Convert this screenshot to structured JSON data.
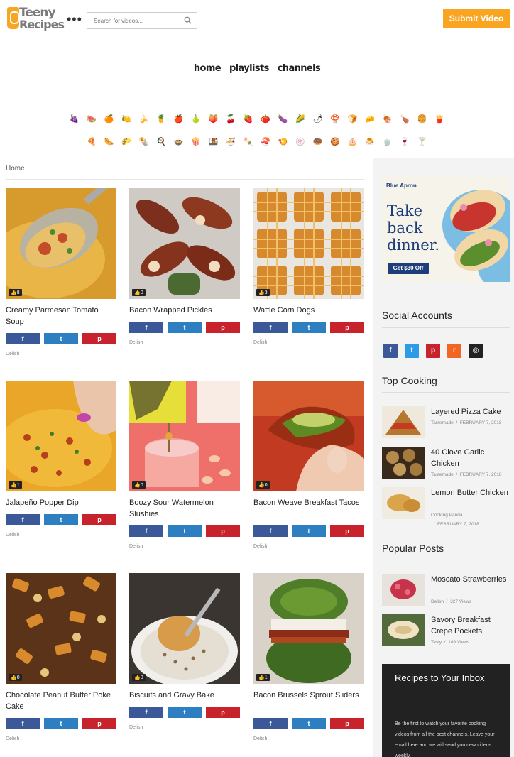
{
  "header": {
    "logo_line1": "Teeny",
    "logo_line2": "Recipes",
    "more_label": "•••",
    "search_placeholder": "Search for videos...",
    "submit_label": "Submit Video"
  },
  "nav": {
    "items": [
      "home",
      "playlists",
      "channels"
    ]
  },
  "categories": {
    "row1": [
      "🍇",
      "🍉",
      "🍊",
      "🍋",
      "🍌",
      "🍍",
      "🍎",
      "🍐",
      "🍑",
      "🍒",
      "🍓",
      "🍅",
      "🍆",
      "🌽",
      "🌶",
      "🍄",
      "🍞",
      "🧀",
      "🍖",
      "🍗",
      "🍔",
      "🍟"
    ],
    "row2": [
      "🍕",
      "🌭",
      "🌮",
      "🌯",
      "🍳",
      "🍲",
      "🍿",
      "🍱",
      "🍜",
      "🍡",
      "🍣",
      "🍤",
      "🍥",
      "🍩",
      "🍪",
      "🎂",
      "🍮",
      "🍵",
      "🍷",
      "🍸"
    ]
  },
  "breadcrumb": "Home",
  "share": {
    "facebook": "f",
    "twitter": "t",
    "pinterest": "p"
  },
  "cards": [
    {
      "title": "Creamy Parmesan Tomato Soup",
      "likes": "8",
      "source": "Delish"
    },
    {
      "title": "Bacon Wrapped Pickles",
      "likes": "0",
      "source": "Delish"
    },
    {
      "title": "Waffle Corn Dogs",
      "likes": "3",
      "source": "Delish"
    },
    {
      "title": "Jalapeño Popper Dip",
      "likes": "1",
      "source": "Delish"
    },
    {
      "title": "Boozy Sour Watermelon Slushies",
      "likes": "0",
      "source": "Delish"
    },
    {
      "title": "Bacon Weave Breakfast Tacos",
      "likes": "0",
      "source": "Delish"
    },
    {
      "title": "Chocolate Peanut Butter Poke Cake",
      "likes": "0",
      "source": "Delish"
    },
    {
      "title": "Biscuits and Gravy Bake",
      "likes": "0",
      "source": "Delish"
    },
    {
      "title": "Bacon Brussels Sprout Sliders",
      "likes": "1",
      "source": "Delish"
    }
  ],
  "ad": {
    "brand": "Blue Apron",
    "line1": "Take",
    "line2": "back",
    "line3": "dinner.",
    "cta": "Get $30 Off"
  },
  "sidebar": {
    "social_title": "Social Accounts",
    "top_title": "Top Cooking",
    "popular_title": "Popular Posts",
    "top_items": [
      {
        "title": "Layered Pizza Cake",
        "source": "Tastemade",
        "date": "FEBRUARY 7, 2018"
      },
      {
        "title": "40 Clove Garlic Chicken",
        "source": "Tastemade",
        "date": "FEBRUARY 7, 2018"
      },
      {
        "title": "Lemon Butter Chicken",
        "source": "Cooking Panda",
        "date": "FEBRUARY 7, 2018"
      }
    ],
    "popular_items": [
      {
        "title": "Moscato Strawberries",
        "source": "Delish",
        "views": "327 Views"
      },
      {
        "title": "Savory Breakfast Crepe Pockets",
        "source": "Tasty",
        "views": "189 Views"
      }
    ],
    "newsletter_title": "Recipes to Your Inbox",
    "newsletter_desc": "Be the first to watch your favorite cooking videos from all the best channels. Leave your email here and we will send you new videos weekly."
  }
}
